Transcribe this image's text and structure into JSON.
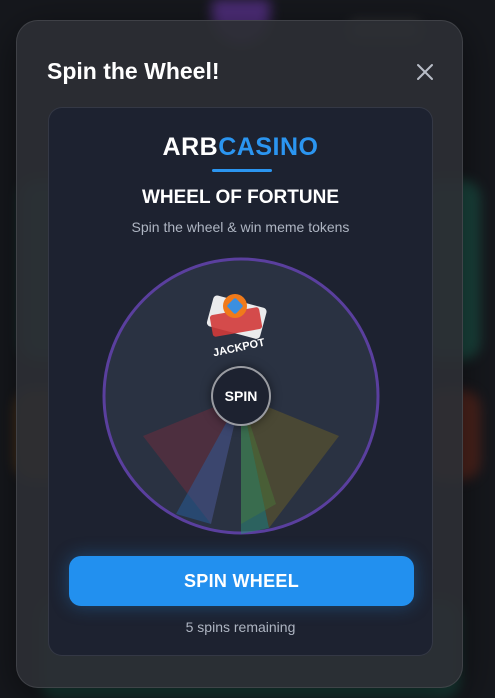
{
  "modal": {
    "title": "Spin the Wheel!",
    "close_icon": "close-icon"
  },
  "brand": {
    "part1": "ARB",
    "part2": "CASINO",
    "accent_color": "#2b95f0"
  },
  "wheel": {
    "title": "WHEEL OF FORTUNE",
    "subtitle": "Spin the wheel & win meme tokens",
    "center_label": "SPIN",
    "segment_labels": [
      "JACKPOT",
      "SPIN"
    ],
    "ring_color": "#5a3f9e"
  },
  "actions": {
    "spin_button_label": "SPIN WHEEL",
    "spins_remaining": "5 spins remaining"
  }
}
